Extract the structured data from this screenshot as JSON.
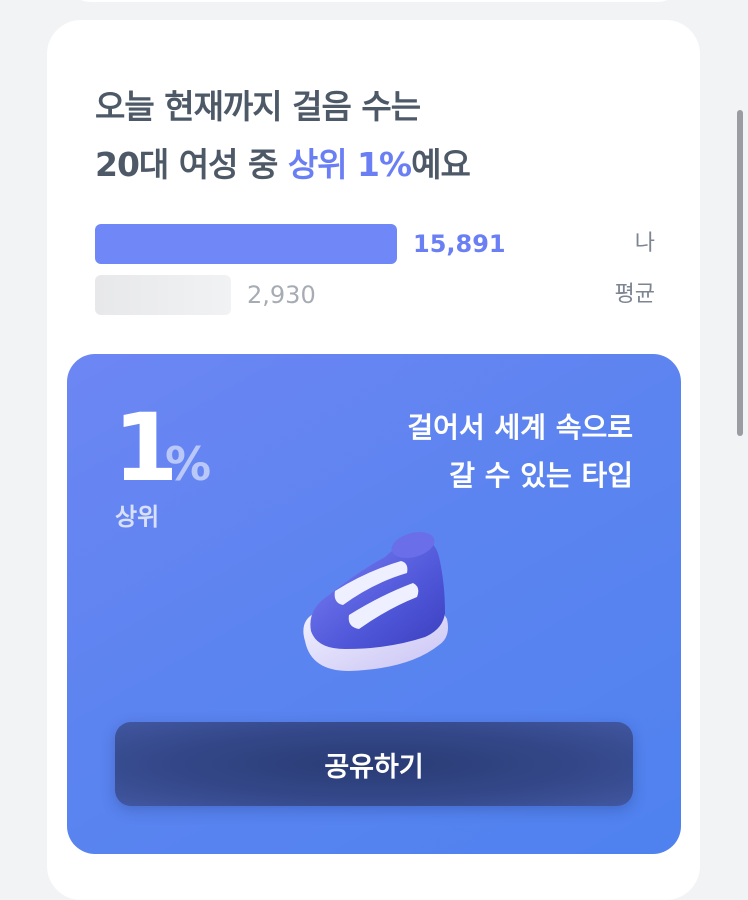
{
  "headline": {
    "line1": "오늘 현재까지 걸음 수는",
    "line2_prefix": "20대 여성 중 ",
    "line2_accent": "상위 1%",
    "line2_suffix": "예요"
  },
  "comparison": {
    "me": {
      "value": "15,891",
      "label": "나",
      "fraction": 0.54
    },
    "average": {
      "value": "2,930",
      "label": "평균",
      "fraction": 0.24
    }
  },
  "result": {
    "rank_number": "1",
    "rank_unit": "%",
    "rank_label": "상위",
    "type_line1": "걸어서 세계 속으로",
    "type_line2": "갈 수 있는 타입",
    "image_icon": "sneaker-icon",
    "share_label": "공유하기"
  },
  "colors": {
    "accent": "#6b7ff5",
    "card_gradient_start": "#6d86f3",
    "card_gradient_end": "#4f82ef",
    "button": "#2f4281"
  }
}
